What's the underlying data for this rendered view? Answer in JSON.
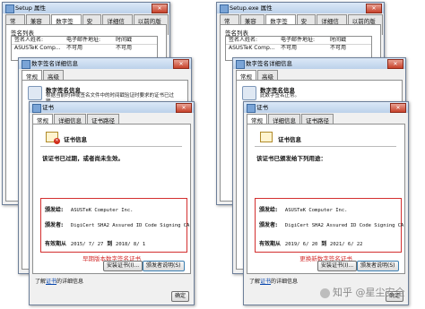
{
  "colors": {
    "highlight": "#d32f2f",
    "link": "#0645ad"
  },
  "left": {
    "prop_title": "Setup 属性",
    "tabs": [
      "常规",
      "兼容性",
      "数字签名",
      "安全",
      "详细信息",
      "以前的版本"
    ],
    "active_tab": 2,
    "siglist_label": "签名列表",
    "siglist_headers": [
      "签名人姓名:",
      "电子邮件地址:",
      "时间戳"
    ],
    "siglist_row": [
      "ASUSTeK Comp...",
      "不可用",
      "不可用"
    ],
    "dsd_title": "数字签名详细信息",
    "dsd_tabs": [
      "常规",
      "高级"
    ],
    "dsd_info_title": "数字签名信息",
    "dsd_info_text": "根据当前时钟或签名文件中的时间戳验证时要求的证书已过期。",
    "cert_title": "证书",
    "cert_tabs": [
      "常规",
      "详细信息",
      "证书路径"
    ],
    "cert_info_title": "证书信息",
    "cert_status": "该证书已过期，或者尚未生效。",
    "issued_to_label": "颁发给:",
    "issued_to": "ASUSTeK Computer Inc.",
    "issued_by_label": "颁发者:",
    "issued_by": "DigiCert SHA2 Assured ID Code Signing CA",
    "valid_label": "有效期从",
    "valid_from": "2015/ 7/ 27",
    "valid_to_word": "到",
    "valid_to": "2018/ 8/ 1",
    "caption": "早期版本数字签名证书",
    "install_btn": "安装证书(I)...",
    "statement_btn": "颁发者说明(S)",
    "learn_prefix": "了解",
    "learn_link": "证书",
    "learn_suffix": "的详细信息",
    "ok_btn": "确定"
  },
  "right": {
    "prop_title": "Setup.exe 属性",
    "tabs": [
      "常规",
      "兼容性",
      "数字签名",
      "安全",
      "详细信息",
      "以前的版本"
    ],
    "active_tab": 2,
    "siglist_label": "签名列表",
    "siglist_headers": [
      "签名人姓名:",
      "电子邮件地址:",
      "时间戳"
    ],
    "siglist_row": [
      "ASUSTeK Comp...",
      "不可用",
      "不可用"
    ],
    "dsd_title": "数字签名详细信息",
    "dsd_tabs": [
      "常规",
      "高级"
    ],
    "dsd_info_title": "数字签名信息",
    "dsd_info_text": "此数字签名正常。",
    "cert_title": "证书",
    "cert_tabs": [
      "常规",
      "详细信息",
      "证书路径"
    ],
    "cert_info_title": "证书信息",
    "cert_status": "该证书已颁发给下列用途：",
    "issued_to_label": "颁发给:",
    "issued_to": "ASUSTeK Computer Inc.",
    "issued_by_label": "颁发者:",
    "issued_by": "DigiCert SHA2 Assured ID Code Signing CA",
    "valid_label": "有效期从",
    "valid_from": "2019/ 6/ 20",
    "valid_to_word": "到",
    "valid_to": "2021/ 6/ 22",
    "caption": "更换新数字签名证书",
    "install_btn": "安装证书(I)...",
    "statement_btn": "颁发者说明(S)",
    "learn_prefix": "了解",
    "learn_link": "证书",
    "learn_suffix": "的详细信息",
    "ok_btn": "确定"
  },
  "watermark": "知乎 @星尘安全"
}
